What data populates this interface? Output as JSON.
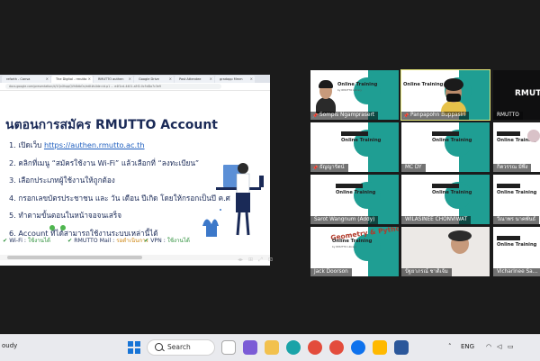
{
  "browser": {
    "tabs": [
      {
        "label": "reforth - Canva"
      },
      {
        "label": "The Digital - rmutto"
      },
      {
        "label": "RMUTTO authen"
      },
      {
        "label": "Google Drive"
      },
      {
        "label": "Post Attendee"
      },
      {
        "label": "gradapp Mmm"
      }
    ],
    "address": "docs.google.com/presentation/d/1QnXhqqQVh8dbOc/edit#slide=id.p1 ... e4f1cd-4401-a5f2-0c5dDa7c3e9"
  },
  "slide": {
    "title": "นตอนการสมัคร RMUTTO Account",
    "steps": [
      {
        "text": "1. เปิดเว็บ ",
        "link": "https://authen.rmutto.ac.th"
      },
      {
        "text": "2. คลิกที่เมนู “สมัครใช้งาน Wi-Fi” แล้วเลือกที่ “ลงทะเบียน”",
        "link": ""
      },
      {
        "text": "3. เลือกประเภทผู้ใช้งานให้ถูกต้อง",
        "link": ""
      },
      {
        "text": "4. กรอกเลขบัตรประชาชน และ วัน เดือน ปีเกิด โดยให้กรอกเป็นปี ค.ศ",
        "link": ""
      },
      {
        "text": "5. ทำตามขั้นตอนในหน้าจอจนเสร็จ",
        "link": ""
      },
      {
        "text": "6. Account ที่ได้สามารถใช้งานระบบเหล่านี้ได้",
        "link": ""
      }
    ],
    "services": [
      {
        "name": "Wi-Fi : ",
        "status": "ใช้งานได้",
        "state": "ok"
      },
      {
        "name": "RMUTTO Mail : ",
        "status": "รอดำเนินการ",
        "state": "pending"
      },
      {
        "name": "VPN : ",
        "status": "ใช้งานได้",
        "state": "ok"
      }
    ]
  },
  "meeting": {
    "banner_title": "Online Training",
    "banner_sub": "by RMUTTO Library",
    "rmutto_logo": "RMUTTO",
    "geometry_banner": "Geometry & Python",
    "participants": [
      {
        "name": "Sompis Ngamprasert",
        "pinned": true,
        "highlight": false
      },
      {
        "name": "Panpapohn Buppasiri",
        "pinned": true,
        "highlight": true
      },
      {
        "name": "RMUTTO",
        "pinned": false,
        "highlight": false
      },
      {
        "name": "ธัญญารัตน์",
        "pinned": true,
        "highlight": false
      },
      {
        "name": "MC DY",
        "pinned": false,
        "highlight": false
      },
      {
        "name": "กิตวรรณ มีพึ่ง",
        "pinned": false,
        "highlight": false
      },
      {
        "name": "Sarot Wangnum (Addy)",
        "pinned": false,
        "highlight": false
      },
      {
        "name": "WILASINEE CHONVIWAT",
        "pinned": false,
        "highlight": false
      },
      {
        "name": "วีณาพร นาคพันธ์",
        "pinned": false,
        "highlight": false
      },
      {
        "name": "Jack Doorson",
        "pinned": false,
        "highlight": false
      },
      {
        "name": "ปัฐยาภรณ์ ชาติเจ้ม",
        "pinned": false,
        "highlight": false
      },
      {
        "name": "Vicharinee Sa...",
        "pinned": false,
        "highlight": false
      }
    ]
  },
  "taskbar": {
    "weather": "oudy",
    "search_label": "Search",
    "language": "ENG",
    "accent": "#1774d6"
  }
}
